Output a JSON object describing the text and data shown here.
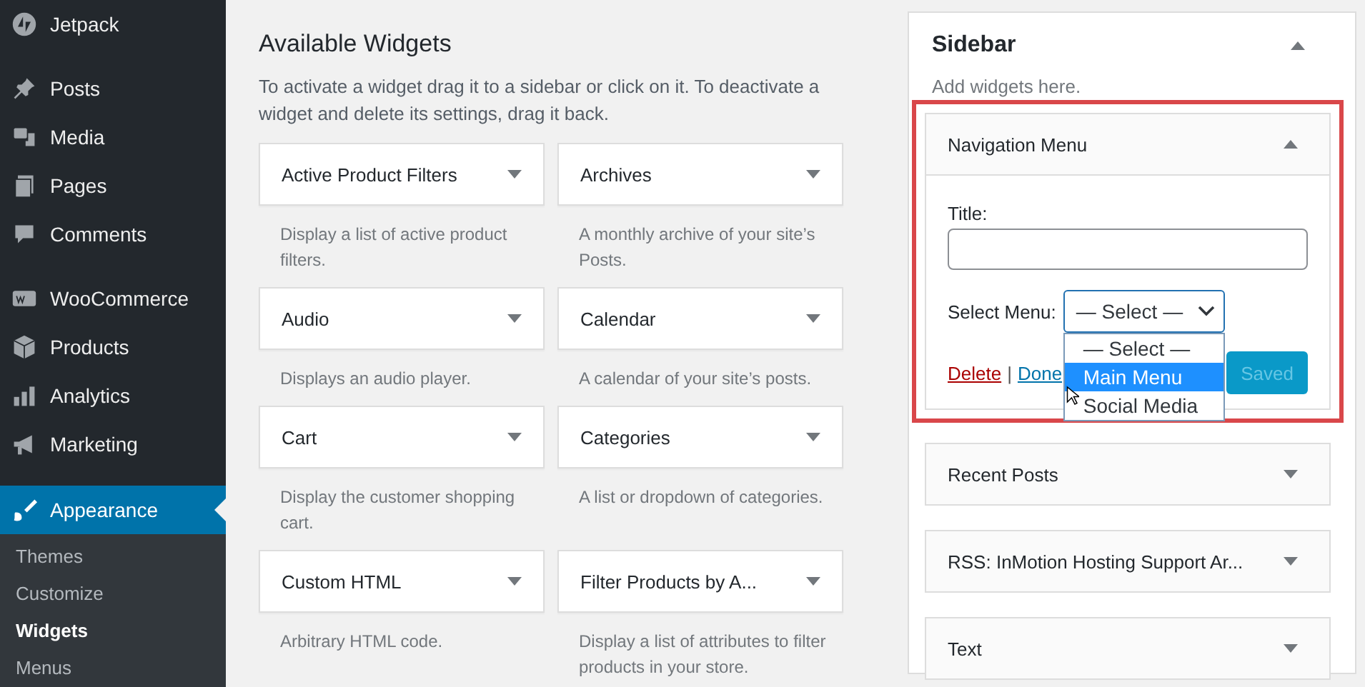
{
  "admin_menu": {
    "items": [
      {
        "label": "Jetpack",
        "selected": false
      },
      {
        "label": "Posts",
        "selected": false
      },
      {
        "label": "Media",
        "selected": false
      },
      {
        "label": "Pages",
        "selected": false
      },
      {
        "label": "Comments",
        "selected": false
      },
      {
        "label": "WooCommerce",
        "selected": false
      },
      {
        "label": "Products",
        "selected": false
      },
      {
        "label": "Analytics",
        "selected": false
      },
      {
        "label": "Marketing",
        "selected": false
      },
      {
        "label": "Appearance",
        "selected": true
      }
    ],
    "submenu": [
      {
        "label": "Themes",
        "selected": false
      },
      {
        "label": "Customize",
        "selected": false
      },
      {
        "label": "Widgets",
        "selected": true
      },
      {
        "label": "Menus",
        "selected": false
      }
    ]
  },
  "available_widgets": {
    "title": "Available Widgets",
    "description": "To activate a widget drag it to a sidebar or click on it. To deactivate a widget and delete its settings, drag it back.",
    "widgets": [
      {
        "title": "Active Product Filters",
        "description": "Display a list of active product filters."
      },
      {
        "title": "Archives",
        "description": "A monthly archive of your site’s Posts."
      },
      {
        "title": "Audio",
        "description": "Displays an audio player."
      },
      {
        "title": "Calendar",
        "description": "A calendar of your site’s posts."
      },
      {
        "title": "Cart",
        "description": "Display the customer shopping cart."
      },
      {
        "title": "Categories",
        "description": "A list or dropdown of categories."
      },
      {
        "title": "Custom HTML",
        "description": "Arbitrary HTML code."
      },
      {
        "title": "Filter Products by A...",
        "description": "Display a list of attributes to filter products in your store."
      }
    ]
  },
  "sidebar": {
    "title": "Sidebar",
    "expanded": true,
    "description": "Add widgets here.",
    "widgets": [
      {
        "title": "Navigation Menu",
        "expanded": true,
        "highlighted": true,
        "form": {
          "title_label": "Title:",
          "select_label": "Select Menu:",
          "select_value": "— Select —",
          "options": [
            {
              "label": "— Select —",
              "selected": false
            },
            {
              "label": "Main Menu",
              "selected": true
            },
            {
              "label": "Social Media",
              "selected": false
            }
          ],
          "delete_link": "Delete",
          "separator": "|",
          "done_link": "Done",
          "save_button": "Saved",
          "save_disabled": true
        }
      },
      {
        "title": "Recent Posts",
        "expanded": false,
        "highlighted": false
      },
      {
        "title": "RSS: InMotion Hosting Support Ar...",
        "expanded": false,
        "highlighted": false
      },
      {
        "title": "Text",
        "expanded": false,
        "highlighted": false
      }
    ]
  }
}
